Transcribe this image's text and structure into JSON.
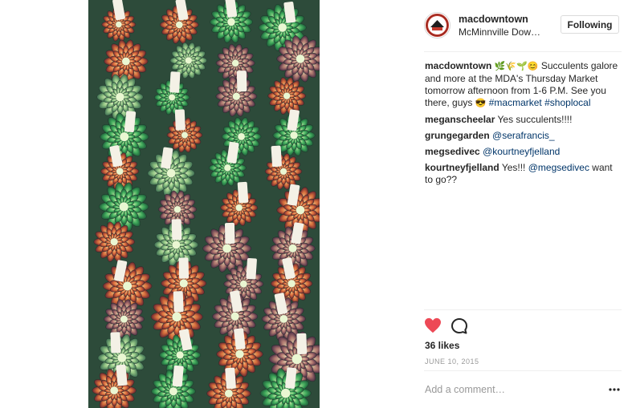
{
  "post": {
    "username": "macdowntown",
    "location": "McMinnville Dow…",
    "follow_label": "Following"
  },
  "caption": {
    "username": "macdowntown",
    "emojis": "🌿🌾🌱😊",
    "text": " Succulents galore and more at the MDA's Thursday Market tomorrow afternoon from 1-6 P.M. See you there, guys ",
    "text_emoji": "😎",
    "hashtag1": "#macmarket",
    "hashtag2": "#shoplocal"
  },
  "comments": [
    {
      "username": "meganscheelar",
      "text": "Yes succulents!!!!",
      "mention": ""
    },
    {
      "username": "grungegarden",
      "text": "",
      "mention": "@serafrancis_"
    },
    {
      "username": "megsedivec",
      "text": "",
      "mention": "@kourtneyfjelland"
    },
    {
      "username": "kourtneyfjelland",
      "text": "Yes!!! ",
      "mention": "@megsedivec",
      "text_after": " want to go??"
    }
  ],
  "likes": "36 likes",
  "date": "JUNE 10, 2015",
  "add_comment_placeholder": "Add a comment…",
  "icons": {
    "like": "heart-icon",
    "comment": "comment-icon",
    "more": "more-options-icon"
  },
  "colors": {
    "like": "#ed4956",
    "link": "#003569",
    "muted": "#999999"
  }
}
